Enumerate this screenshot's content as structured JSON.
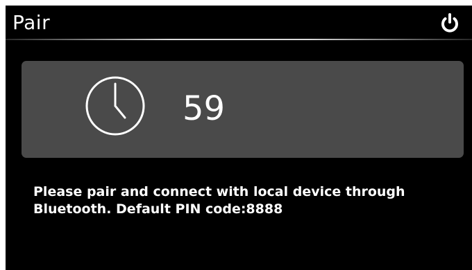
{
  "header": {
    "title": "Pair",
    "power_icon": "power-icon"
  },
  "timer": {
    "icon": "clock-icon",
    "countdown": "59"
  },
  "message": {
    "text": "Please pair and connect with local device through\n Bluetooth. Default PIN code:8888"
  },
  "colors": {
    "background": "#000000",
    "panel": "#4a4a4a",
    "text": "#ffffff"
  }
}
